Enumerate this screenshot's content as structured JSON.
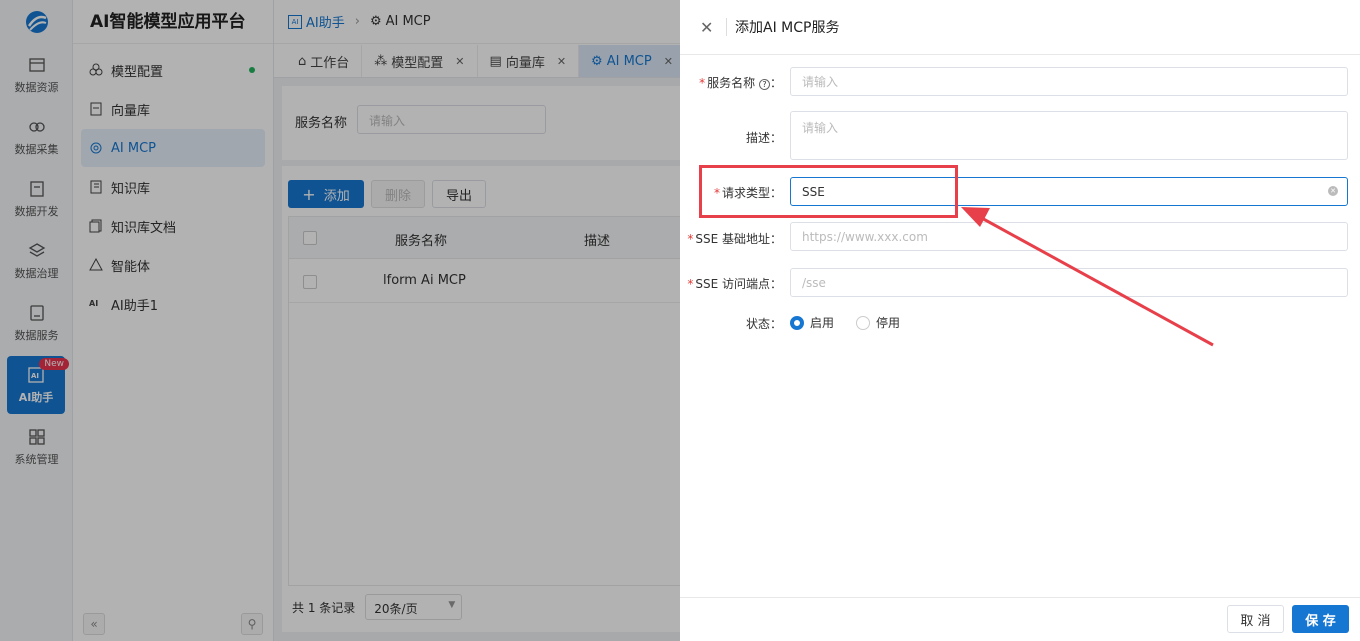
{
  "app": {
    "title": "AI智能模型应用平台"
  },
  "rail": {
    "items": [
      {
        "label": "数据资源",
        "icon": "data-resource-icon"
      },
      {
        "label": "数据采集",
        "icon": "data-collect-icon"
      },
      {
        "label": "数据开发",
        "icon": "data-dev-icon"
      },
      {
        "label": "数据治理",
        "icon": "data-govern-icon"
      },
      {
        "label": "数据服务",
        "icon": "data-service-icon"
      },
      {
        "label": "AI助手",
        "icon": "ai-assistant-icon",
        "badge": "New"
      },
      {
        "label": "系统管理",
        "icon": "system-admin-icon"
      }
    ]
  },
  "sidebar": {
    "items": [
      {
        "label": "模型配置",
        "icon": "model-config-icon"
      },
      {
        "label": "向量库",
        "icon": "vector-db-icon"
      },
      {
        "label": "AI MCP",
        "icon": "mcp-icon"
      },
      {
        "label": "知识库",
        "icon": "knowledge-icon"
      },
      {
        "label": "知识库文档",
        "icon": "knowledge-doc-icon"
      },
      {
        "label": "智能体",
        "icon": "agent-icon"
      },
      {
        "label": "AI助手1",
        "icon": "ai-icon"
      }
    ]
  },
  "breadcrumb": {
    "parent": "AI助手",
    "current": "AI MCP"
  },
  "tabs": [
    {
      "label": "工作台"
    },
    {
      "label": "模型配置"
    },
    {
      "label": "向量库"
    },
    {
      "label": "AI MCP"
    }
  ],
  "search": {
    "label": "服务名称",
    "placeholder": "请输入"
  },
  "toolbar": {
    "add": "添加",
    "delete": "删除",
    "export": "导出"
  },
  "table": {
    "columns": [
      "服务名称",
      "描述"
    ],
    "rows": [
      {
        "name": "lform Ai MCP",
        "desc": ""
      }
    ]
  },
  "pager": {
    "total": "共 1 条记录",
    "page_size": "20条/页"
  },
  "drawer": {
    "title": "添加AI MCP服务",
    "fields": {
      "service_name": {
        "label": "服务名称",
        "placeholder": "请输入"
      },
      "description": {
        "label": "描述：",
        "placeholder": "请输入"
      },
      "request_type": {
        "label": "请求类型：",
        "value": "SSE"
      },
      "sse_base": {
        "label": "SSE 基础地址：",
        "placeholder": "https://www.xxx.com"
      },
      "sse_endpoint": {
        "label": "SSE 访问端点：",
        "placeholder": "/sse"
      },
      "status": {
        "label": "状态：",
        "options": [
          "启用",
          "停用"
        ],
        "selected": "启用"
      }
    },
    "cancel": "取 消",
    "save": "保 存"
  },
  "colors": {
    "primary": "#1677d2",
    "highlight": "#e8404a"
  }
}
